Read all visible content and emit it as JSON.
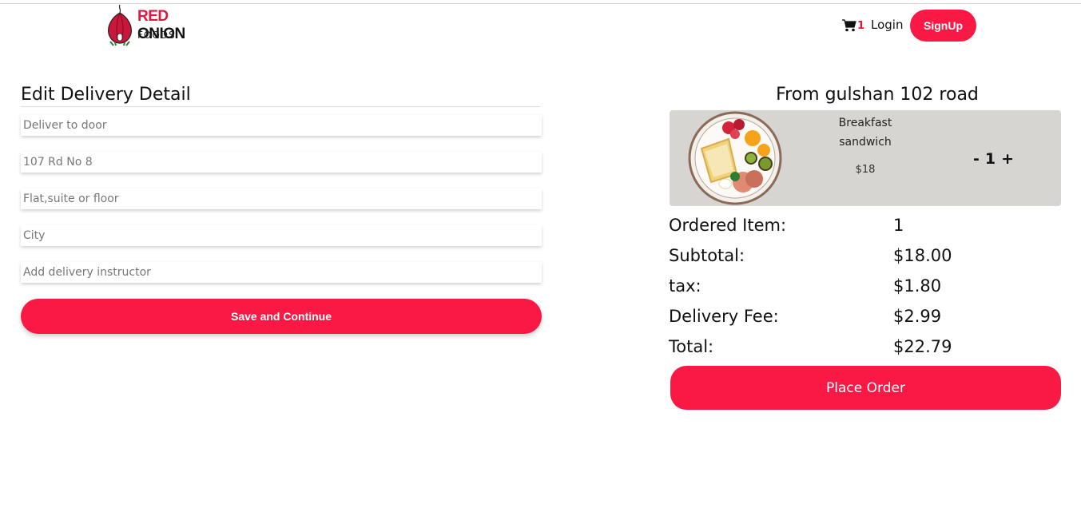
{
  "brand": {
    "name_red": "RED",
    "name_black": "ONION",
    "tagline": "FOODS"
  },
  "header": {
    "cart_count": "1",
    "login_label": "Login",
    "signup_label": "SignUp"
  },
  "delivery_form": {
    "title": "Edit Delivery Detail",
    "fields": [
      {
        "placeholder": "Deliver to door",
        "value": ""
      },
      {
        "placeholder": "107 Rd No 8",
        "value": ""
      },
      {
        "placeholder": "Flat,suite or floor",
        "value": ""
      },
      {
        "placeholder": "City",
        "value": ""
      },
      {
        "placeholder": "Add delivery instructor",
        "value": ""
      }
    ],
    "submit_label": "Save and Continue"
  },
  "order": {
    "from_label": "From gulshan 102 road",
    "item": {
      "name": "Breakfast sandwich",
      "price": "$18",
      "qty": "1",
      "minus": "-",
      "plus": "+"
    },
    "summary": [
      {
        "label": "Ordered Item:",
        "value": "1"
      },
      {
        "label": "Subtotal:",
        "value": "$18.00"
      },
      {
        "label": "tax:",
        "value": "$1.80"
      },
      {
        "label": "Delivery Fee:",
        "value": "$2.99"
      },
      {
        "label": "Total:",
        "value": "$22.79"
      }
    ],
    "place_order_label": "Place Order"
  },
  "colors": {
    "accent": "#f91944",
    "card_bg": "#d7d5d1"
  },
  "icons": [
    "onion-logo-icon",
    "cart-icon",
    "food-plate-image"
  ]
}
